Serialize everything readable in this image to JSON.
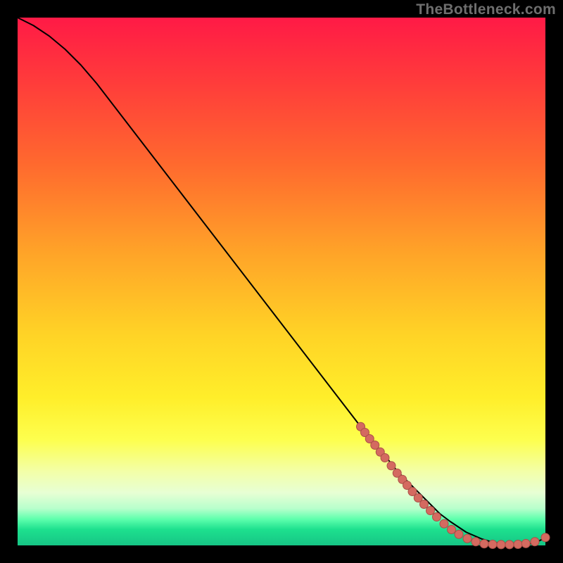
{
  "watermark": "TheBottleneck.com",
  "colors": {
    "curve": "#000000",
    "marker_fill": "#d46a60",
    "marker_stroke": "#aa4f47"
  },
  "chart_data": {
    "type": "line",
    "title": "",
    "xlabel": "",
    "ylabel": "",
    "xlim": [
      0,
      100
    ],
    "ylim": [
      0,
      100
    ],
    "grid": false,
    "legend": false,
    "series": [
      {
        "name": "curve",
        "x": [
          0,
          3,
          6,
          9,
          12,
          15,
          20,
          25,
          30,
          35,
          40,
          45,
          50,
          55,
          60,
          65,
          70,
          72,
          75,
          78,
          80,
          82,
          85,
          88,
          90,
          92,
          94,
          96,
          98,
          100
        ],
        "y": [
          100,
          98.5,
          96.5,
          94,
          91,
          87.5,
          81,
          74.5,
          68,
          61.5,
          55,
          48.5,
          42,
          35.5,
          29,
          22.5,
          16.5,
          14,
          11,
          8,
          6,
          4.5,
          2.5,
          1.2,
          0.6,
          0.3,
          0.2,
          0.2,
          0.4,
          1.5
        ]
      }
    ],
    "markers": [
      {
        "x": 65.0,
        "y": 22.5
      },
      {
        "x": 65.8,
        "y": 21.4
      },
      {
        "x": 66.7,
        "y": 20.2
      },
      {
        "x": 67.7,
        "y": 19.0
      },
      {
        "x": 68.7,
        "y": 17.7
      },
      {
        "x": 69.6,
        "y": 16.6
      },
      {
        "x": 70.8,
        "y": 15.1
      },
      {
        "x": 71.9,
        "y": 13.7
      },
      {
        "x": 72.9,
        "y": 12.5
      },
      {
        "x": 73.8,
        "y": 11.4
      },
      {
        "x": 74.8,
        "y": 10.2
      },
      {
        "x": 75.9,
        "y": 9.0
      },
      {
        "x": 77.0,
        "y": 7.8
      },
      {
        "x": 78.2,
        "y": 6.6
      },
      {
        "x": 79.4,
        "y": 5.4
      },
      {
        "x": 80.8,
        "y": 4.1
      },
      {
        "x": 82.2,
        "y": 3.0
      },
      {
        "x": 83.6,
        "y": 2.1
      },
      {
        "x": 85.2,
        "y": 1.3
      },
      {
        "x": 86.8,
        "y": 0.7
      },
      {
        "x": 88.4,
        "y": 0.3
      },
      {
        "x": 90.0,
        "y": 0.2
      },
      {
        "x": 91.6,
        "y": 0.15
      },
      {
        "x": 93.2,
        "y": 0.15
      },
      {
        "x": 94.8,
        "y": 0.2
      },
      {
        "x": 96.3,
        "y": 0.35
      },
      {
        "x": 98.0,
        "y": 0.7
      },
      {
        "x": 100.0,
        "y": 1.5
      }
    ]
  }
}
